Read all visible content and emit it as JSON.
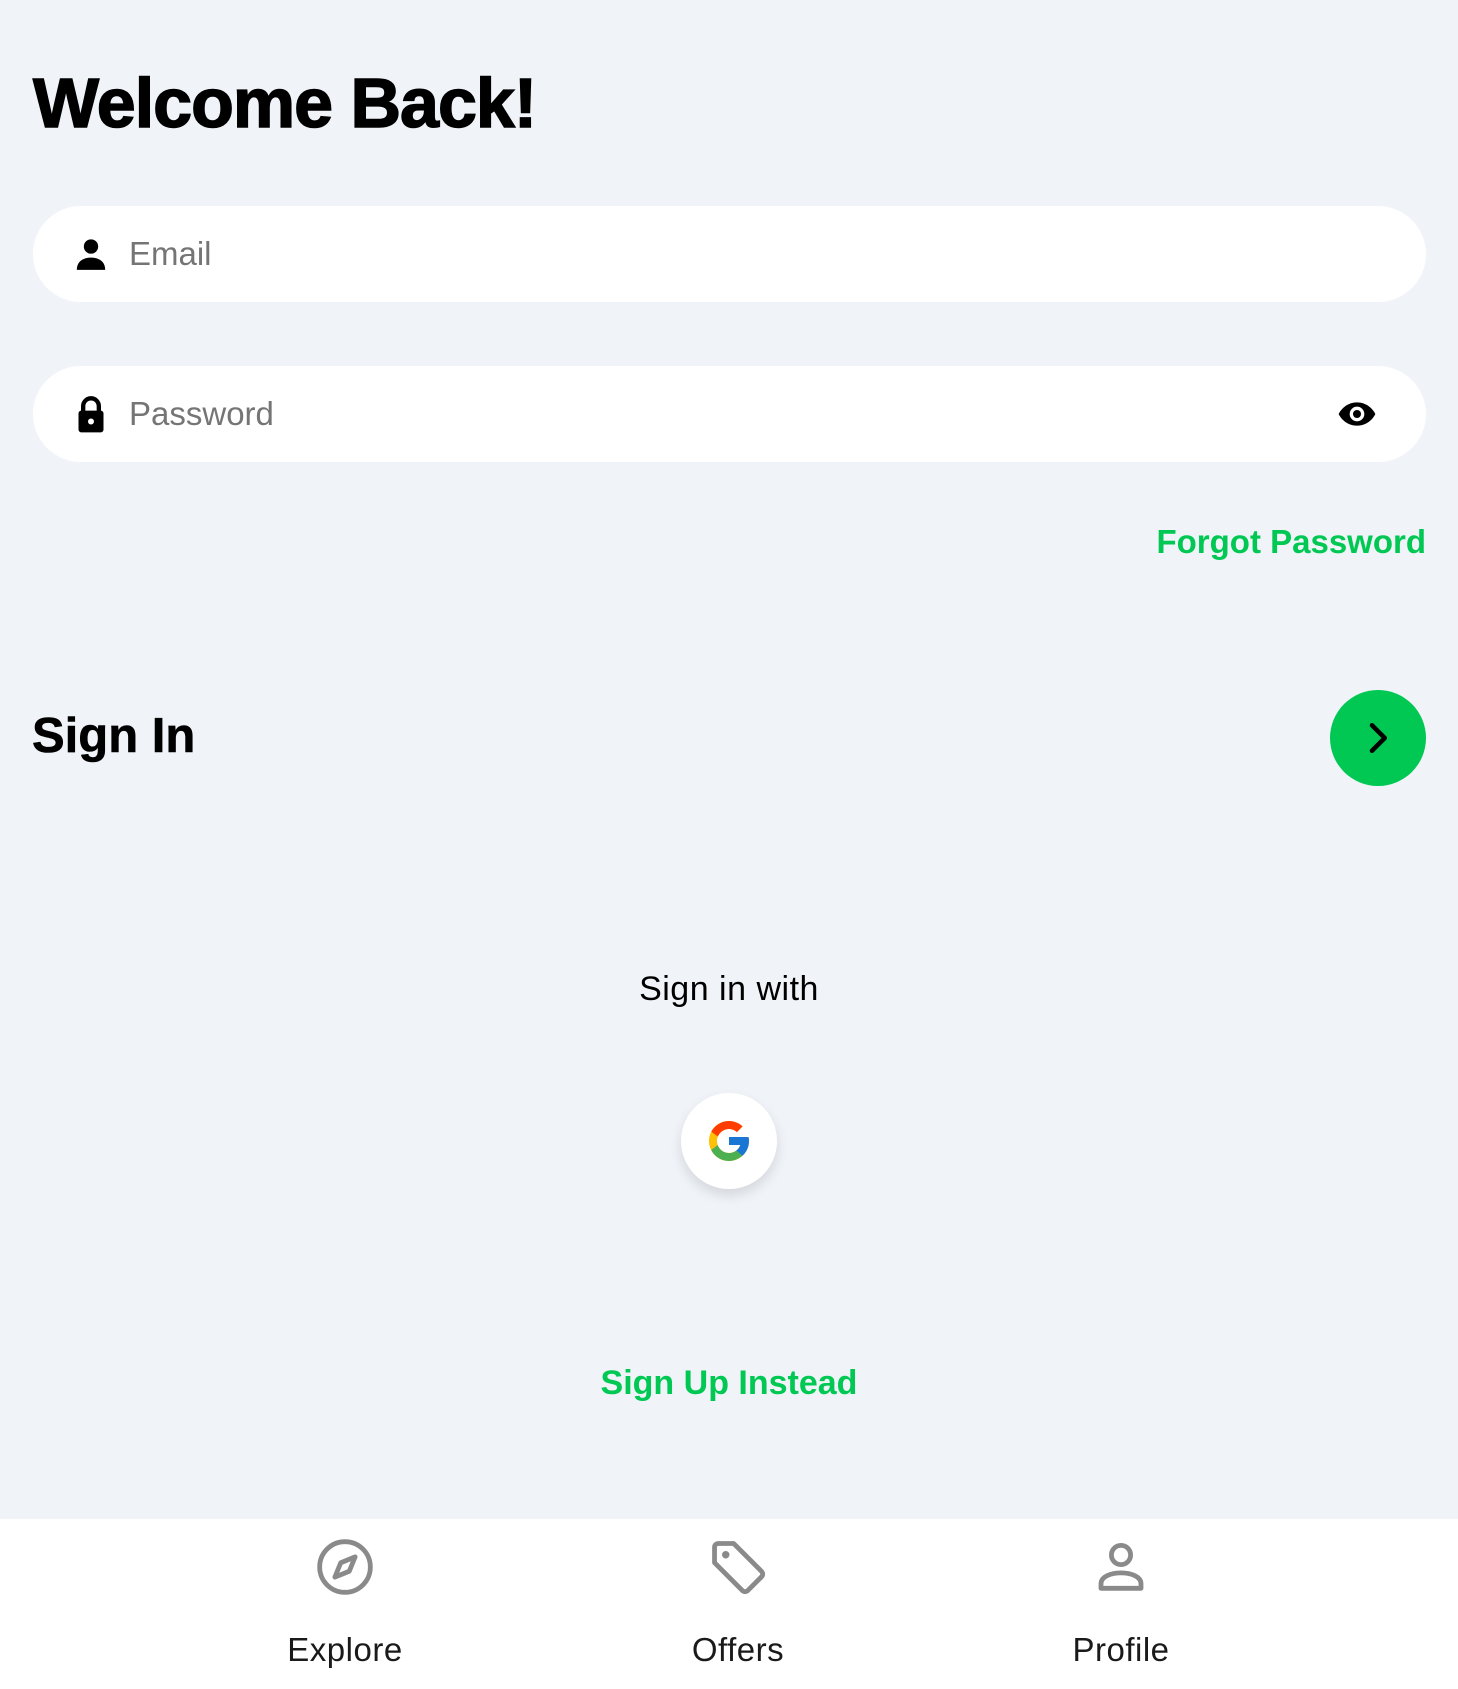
{
  "page": {
    "title": "Welcome Back!"
  },
  "form": {
    "email": {
      "placeholder": "Email",
      "value": "",
      "icon": "person-icon"
    },
    "password": {
      "placeholder": "Password",
      "value": "",
      "icon": "lock-icon",
      "toggle_icon": "eye-icon"
    },
    "forgot_password_label": "Forgot Password",
    "sign_in_label": "Sign In",
    "sign_in_button_icon": "chevron-right-icon"
  },
  "social": {
    "label": "Sign in with",
    "providers": [
      {
        "name": "google",
        "icon": "google-icon"
      }
    ]
  },
  "sign_up_label": "Sign Up Instead",
  "bottom_nav": {
    "items": [
      {
        "label": "Explore",
        "icon": "compass-icon"
      },
      {
        "label": "Offers",
        "icon": "tag-icon"
      },
      {
        "label": "Profile",
        "icon": "person-outline-icon"
      }
    ]
  },
  "colors": {
    "background": "#F0F4F9",
    "accent": "#00C853",
    "surface": "#FFFFFF",
    "text": "#000000",
    "placeholder": "#757575",
    "nav_icon": "#8A8A8A"
  }
}
